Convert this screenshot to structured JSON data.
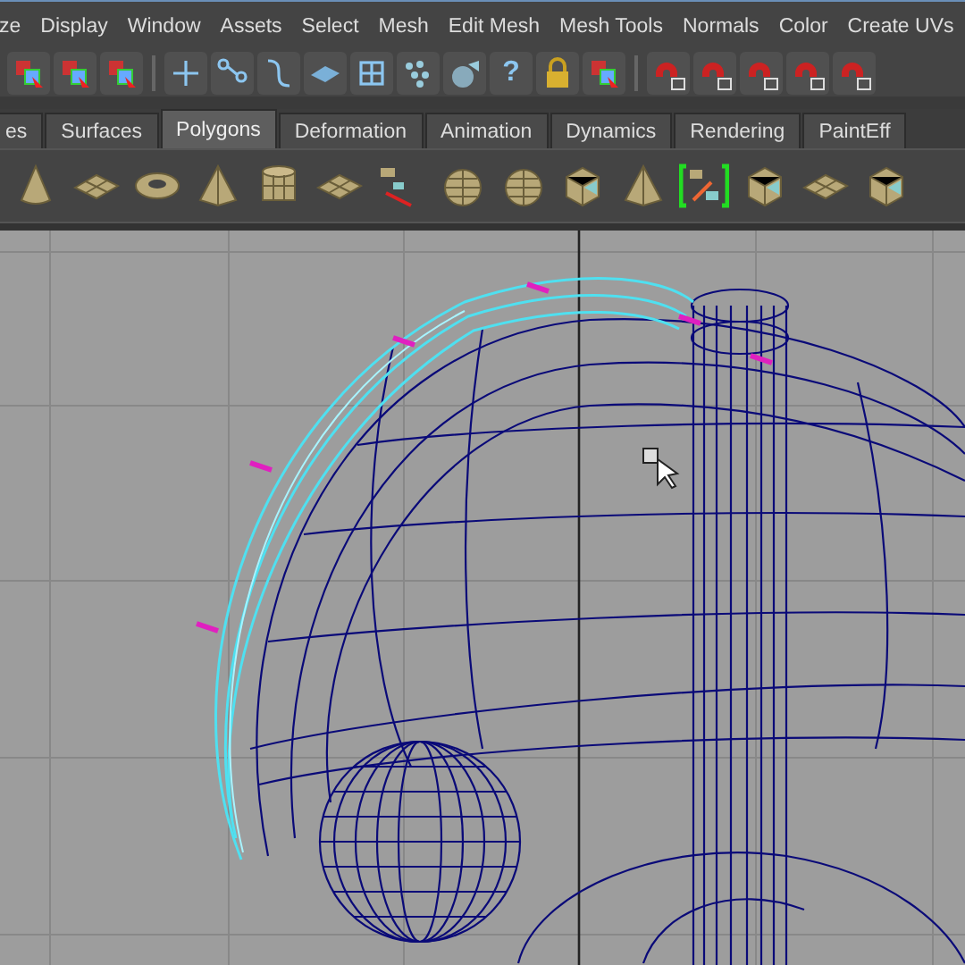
{
  "menu_bar": {
    "items": [
      "ze",
      "Display",
      "Window",
      "Assets",
      "Select",
      "Mesh",
      "Edit Mesh",
      "Mesh Tools",
      "Normals",
      "Color",
      "Create UVs"
    ]
  },
  "status_line": {
    "help_glyph": "?"
  },
  "shelf_tabs": [
    {
      "label": "es",
      "selected": false
    },
    {
      "label": "Surfaces",
      "selected": false
    },
    {
      "label": "Polygons",
      "selected": true
    },
    {
      "label": "Deformation",
      "selected": false
    },
    {
      "label": "Animation",
      "selected": false
    },
    {
      "label": "Dynamics",
      "selected": false
    },
    {
      "label": "Rendering",
      "selected": false
    },
    {
      "label": "PaintEff",
      "selected": false
    }
  ]
}
